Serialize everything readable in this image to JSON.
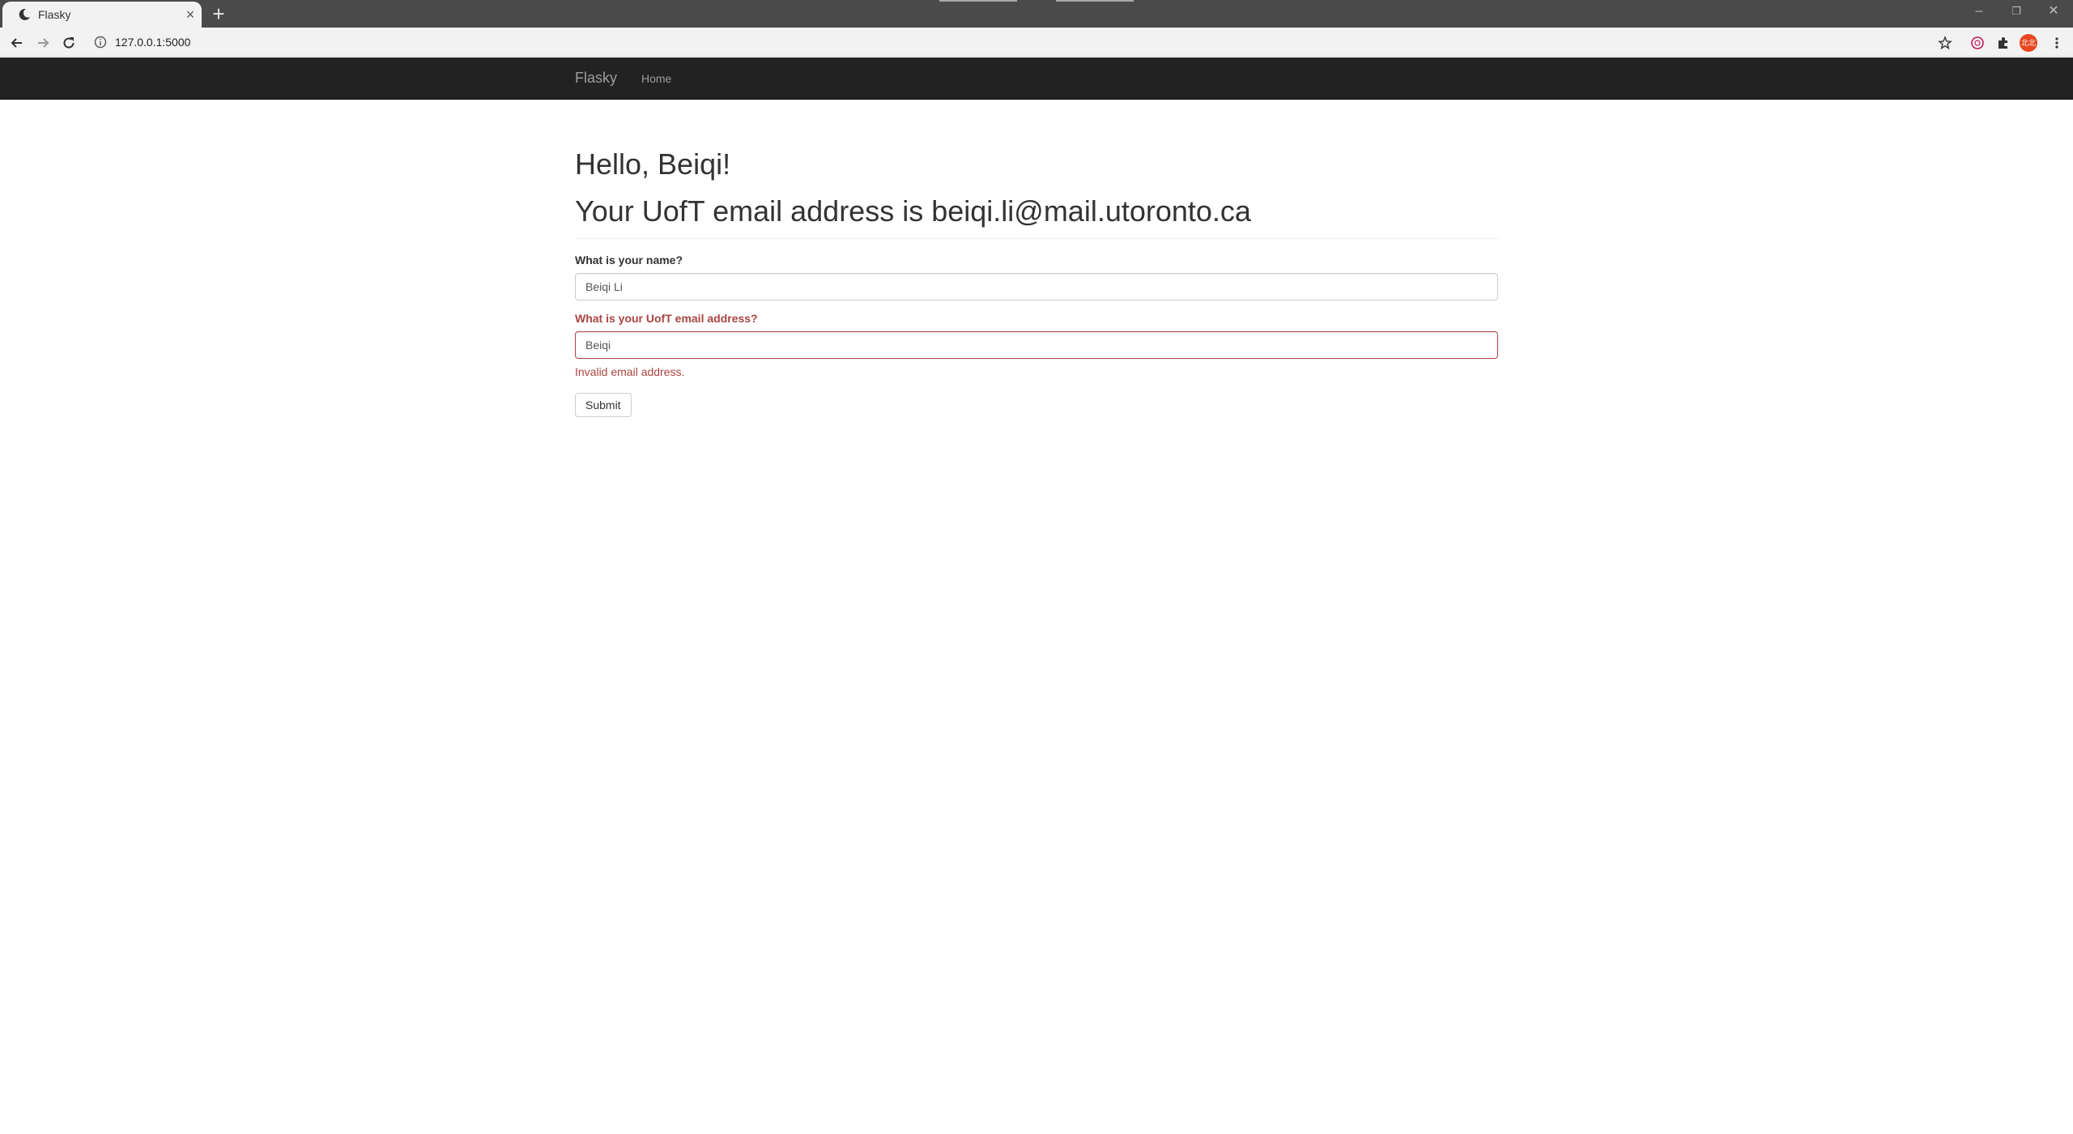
{
  "browser": {
    "tab_title": "Flasky",
    "tab_close": "×",
    "new_tab": "+",
    "url": "127.0.0.1:5000",
    "avatar_text": "北北",
    "window_controls": [
      "–",
      "❐",
      "✕"
    ]
  },
  "navbar": {
    "brand": "Flasky",
    "links": [
      "Home"
    ]
  },
  "header": {
    "greeting": "Hello, Beiqi!",
    "email_line": "Your UofT email address is beiqi.li@mail.utoronto.ca"
  },
  "form": {
    "name_label": "What is your name?",
    "name_value": "Beiqi Li",
    "email_label": "What is your UofT email address?",
    "email_value": "Beiqi",
    "email_error": "Invalid email address.",
    "submit_label": "Submit"
  },
  "colors": {
    "navbar_bg": "#222222",
    "error": "#a94442",
    "avatar_bg": "#e8461f"
  }
}
